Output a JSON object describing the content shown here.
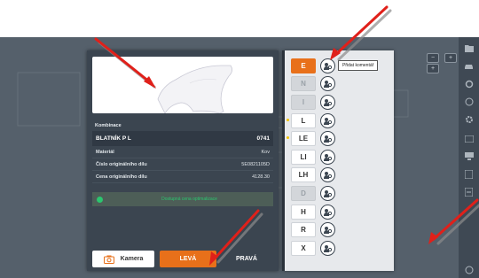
{
  "dialog": {
    "section_title": "Kombinace",
    "part": {
      "name": "BLATNÍK P L",
      "code": "0741"
    },
    "fields": [
      {
        "label": "Materiál",
        "value": "Kov"
      },
      {
        "label": "Číslo originálního dílu",
        "value": "5E0821105D"
      },
      {
        "label": "Cena originálního dílu",
        "value": "4128.30"
      }
    ],
    "notice": "Dostupná cena optimalizace",
    "buttons": {
      "camera": "Kamera",
      "left": "LEVÁ",
      "right": "PRAVÁ"
    }
  },
  "panel": {
    "tooltip": "Přidat komentář",
    "combinations": [
      {
        "code": "E",
        "state": "active",
        "icon": "person-settings-icon"
      },
      {
        "code": "N",
        "state": "disabled",
        "icon": "person-settings-icon"
      },
      {
        "code": "I",
        "state": "disabled",
        "icon": "person-settings-icon"
      },
      {
        "code": "L",
        "state": "marked",
        "icon": "person-settings-icon"
      },
      {
        "code": "LE",
        "state": "marked",
        "icon": "person-settings-icon"
      },
      {
        "code": "LI",
        "state": "normal",
        "icon": "person-settings-icon"
      },
      {
        "code": "LH",
        "state": "normal",
        "icon": "person-settings-icon"
      },
      {
        "code": "D",
        "state": "disabled",
        "icon": "person-settings-icon"
      },
      {
        "code": "H",
        "state": "normal",
        "icon": "person-settings-icon"
      },
      {
        "code": "R",
        "state": "normal",
        "icon": "person-settings-icon"
      },
      {
        "code": "X",
        "state": "normal",
        "icon": "person-settings-icon"
      }
    ]
  },
  "rail_icons": [
    "folder-icon",
    "car-icon",
    "settings-icon",
    "help-icon",
    "gear-icon",
    "list-icon",
    "calculator-icon",
    "document-icon",
    "export-icon",
    "info-icon"
  ],
  "colors": {
    "accent": "#e8701a",
    "dialog_bg": "#3b4550",
    "notice_green": "#2bc66f",
    "pointer_red": "#e0201a"
  }
}
